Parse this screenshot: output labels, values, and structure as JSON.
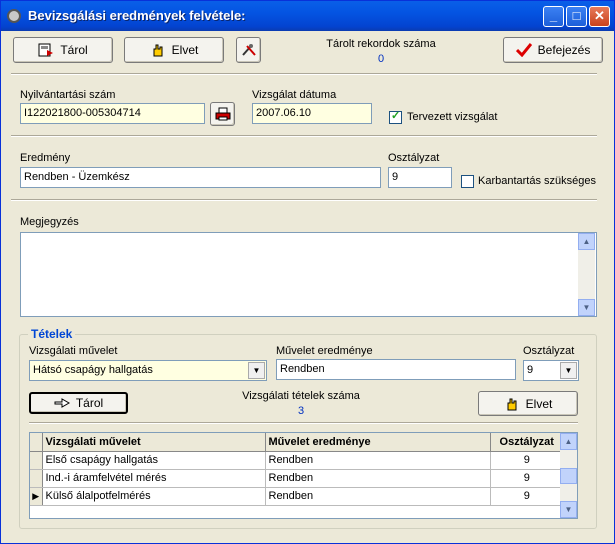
{
  "window": {
    "title": "Bevizsgálási eredmények felvétele:"
  },
  "toolbar": {
    "save_label": "Tárol",
    "discard_label": "Elvet",
    "finish_label": "Befejezés",
    "saved_records_label": "Tárolt rekordok száma",
    "saved_records_count": "0"
  },
  "form": {
    "reg_number_label": "Nyilvántartási szám",
    "reg_number_value": "I122021800-005304714",
    "date_label": "Vizsgálat dátuma",
    "date_value": "2007.06.10",
    "planned_label": "Tervezett vizsgálat",
    "planned_checked": true,
    "result_label": "Eredmény",
    "result_value": "Rendben - Üzemkész",
    "grade_label": "Osztályzat",
    "grade_value": "9",
    "maintenance_label": "Karbantartás szükséges",
    "maintenance_checked": false,
    "note_label": "Megjegyzés",
    "note_value": ""
  },
  "items": {
    "group_title": "Tételek",
    "operation_label": "Vizsgálati művelet",
    "operation_value": "Hátsó csapágy hallgatás",
    "op_result_label": "Művelet eredménye",
    "op_result_value": "Rendben",
    "grade_label": "Osztályzat",
    "grade_value": "9",
    "save_label": "Tárol",
    "discard_label": "Elvet",
    "count_label": "Vizsgálati tételek száma",
    "count_value": "3",
    "columns": [
      "Vizsgálati művelet",
      "Művelet eredménye",
      "Osztályzat"
    ],
    "rows": [
      [
        "Első csapágy hallgatás",
        "Rendben",
        "9"
      ],
      [
        "Ind.-i áramfelvétel mérés",
        "Rendben",
        "9"
      ],
      [
        "Külső álalpotfelmérés",
        "Rendben",
        "9"
      ]
    ]
  },
  "colors": {
    "titlebar": "#0454e2",
    "accent_blue": "#0030c0",
    "required_field": "#ffffe1"
  }
}
